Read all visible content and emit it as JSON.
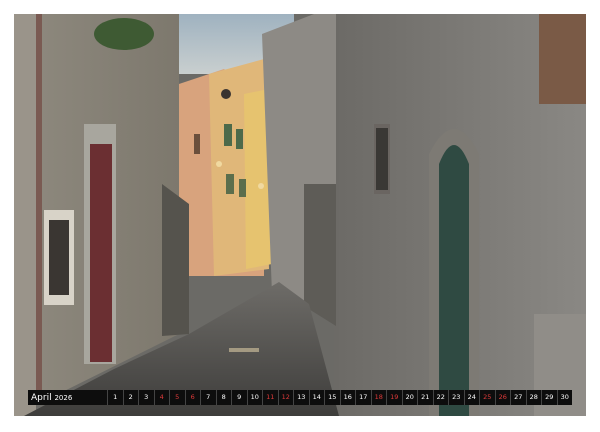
{
  "calendar": {
    "month": "April",
    "year": "2026",
    "days": [
      {
        "n": "1",
        "weekend": false
      },
      {
        "n": "2",
        "weekend": false
      },
      {
        "n": "3",
        "weekend": false
      },
      {
        "n": "4",
        "weekend": true
      },
      {
        "n": "5",
        "weekend": true
      },
      {
        "n": "6",
        "weekend": true
      },
      {
        "n": "7",
        "weekend": false
      },
      {
        "n": "8",
        "weekend": false
      },
      {
        "n": "9",
        "weekend": false
      },
      {
        "n": "10",
        "weekend": false
      },
      {
        "n": "11",
        "weekend": true
      },
      {
        "n": "12",
        "weekend": true
      },
      {
        "n": "13",
        "weekend": false
      },
      {
        "n": "14",
        "weekend": false
      },
      {
        "n": "15",
        "weekend": false
      },
      {
        "n": "16",
        "weekend": false
      },
      {
        "n": "17",
        "weekend": false
      },
      {
        "n": "18",
        "weekend": true
      },
      {
        "n": "19",
        "weekend": true
      },
      {
        "n": "20",
        "weekend": false
      },
      {
        "n": "21",
        "weekend": false
      },
      {
        "n": "22",
        "weekend": false
      },
      {
        "n": "23",
        "weekend": false
      },
      {
        "n": "24",
        "weekend": false
      },
      {
        "n": "25",
        "weekend": true
      },
      {
        "n": "26",
        "weekend": true
      },
      {
        "n": "27",
        "weekend": false
      },
      {
        "n": "28",
        "weekend": false
      },
      {
        "n": "29",
        "weekend": false
      },
      {
        "n": "30",
        "weekend": false
      }
    ]
  },
  "colors": {
    "weekend": "#e03a3a",
    "weekday": "#ffffff",
    "bar": "#0d0d0d"
  }
}
